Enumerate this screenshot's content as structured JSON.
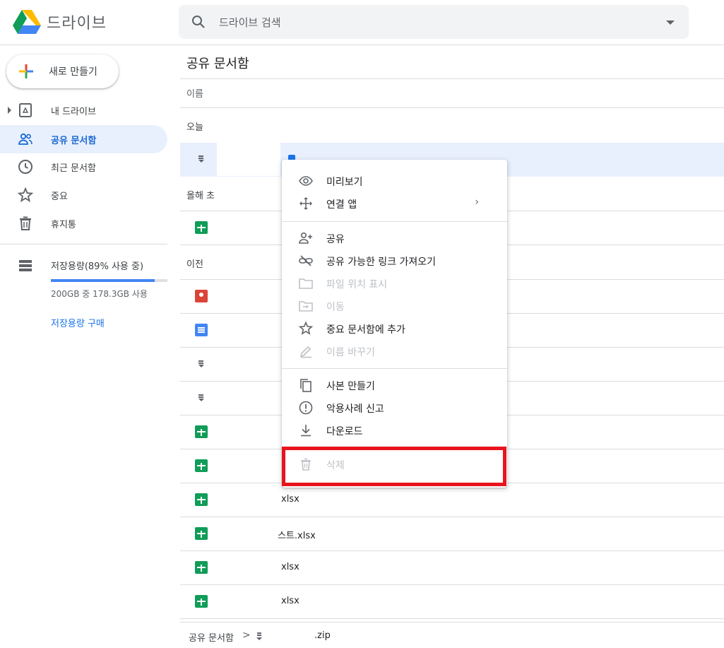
{
  "header": {
    "brand": "드라이브",
    "search_placeholder": "드라이브 검색"
  },
  "sidebar": {
    "new_label": "새로 만들기",
    "items": [
      {
        "label": "내 드라이브",
        "icon": "my-drive-icon"
      },
      {
        "label": "공유 문서함",
        "icon": "shared-people-icon",
        "active": true
      },
      {
        "label": "최근 문서함",
        "icon": "clock-icon"
      },
      {
        "label": "중요",
        "icon": "star-icon"
      },
      {
        "label": "휴지통",
        "icon": "trash-icon"
      }
    ],
    "storage": {
      "title": "저장용량(89% 사용 중)",
      "usage_text": "200GB 중 178.3GB 사용",
      "used_fraction": 0.89,
      "buy_label": "저장용량 구매"
    }
  },
  "main": {
    "title": "공유 문서함",
    "column_name": "이름",
    "sections": [
      "오늘",
      "올해 초",
      "이전"
    ],
    "rows": [
      {
        "type": "zip",
        "name": ""
      },
      {
        "type": "sheet",
        "name": ""
      },
      {
        "type": "map",
        "name": ""
      },
      {
        "type": "doc",
        "name": ""
      },
      {
        "type": "zip",
        "name": ""
      },
      {
        "type": "zip",
        "name": ""
      },
      {
        "type": "sheet",
        "name": ""
      },
      {
        "type": "sheet",
        "name": ""
      },
      {
        "type": "sheet",
        "name": "xlsx"
      },
      {
        "type": "sheet",
        "name": "스트.xlsx"
      },
      {
        "type": "sheet",
        "name": "xlsx"
      },
      {
        "type": "sheet",
        "name": "xlsx"
      }
    ]
  },
  "footer": {
    "breadcrumb": "공유 문서함",
    "chevron": ">",
    "file_name": ".zip"
  },
  "context_menu": {
    "items": [
      {
        "label": "미리보기",
        "icon": "eye-icon",
        "enabled": true
      },
      {
        "label": "연결 앱",
        "icon": "move-arrows-icon",
        "enabled": true,
        "submenu": "›"
      },
      {
        "label": "공유",
        "icon": "person-add-icon",
        "enabled": true
      },
      {
        "label": "공유 가능한 링크 가져오기",
        "icon": "link-icon",
        "enabled": true
      },
      {
        "label": "파일 위치 표시",
        "icon": "folder-icon",
        "enabled": false
      },
      {
        "label": "이동",
        "icon": "folder-move-icon",
        "enabled": false
      },
      {
        "label": "중요 문서함에 추가",
        "icon": "star-icon",
        "enabled": true
      },
      {
        "label": "이름 바꾸기",
        "icon": "pencil-icon",
        "enabled": false
      },
      {
        "label": "사본 만들기",
        "icon": "copy-icon",
        "enabled": true
      },
      {
        "label": "악용사례 신고",
        "icon": "report-icon",
        "enabled": true
      },
      {
        "label": "다운로드",
        "icon": "download-icon",
        "enabled": true
      },
      {
        "label": "삭제",
        "icon": "trash-icon",
        "enabled": false
      }
    ]
  },
  "colors": {
    "accent": "#1a73e8",
    "active_bg": "#e8f0fe",
    "highlight_border": "#e8141d"
  }
}
